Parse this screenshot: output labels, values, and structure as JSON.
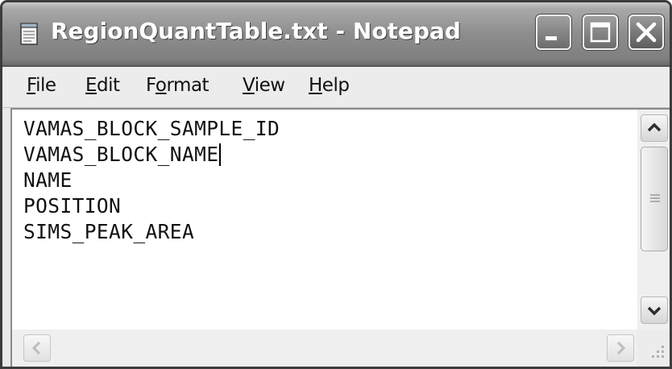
{
  "window": {
    "title": "RegionQuantTable.txt - Notepad",
    "icons": {
      "app": "notepad-icon",
      "minimize": "minimize-icon",
      "maximize": "maximize-icon",
      "close": "close-icon"
    }
  },
  "menu": [
    {
      "mnemonic": "F",
      "rest": "ile"
    },
    {
      "mnemonic": "E",
      "rest": "dit"
    },
    {
      "pre": "F",
      "mnemonic": "o",
      "rest": "rmat"
    },
    {
      "mnemonic": "V",
      "rest": "iew"
    },
    {
      "mnemonic": "H",
      "rest": "elp"
    }
  ],
  "editor": {
    "lines": [
      "VAMAS_BLOCK_SAMPLE_ID",
      "VAMAS_BLOCK_NAME",
      "NAME",
      "POSITION",
      "SIMS_PEAK_AREA"
    ]
  },
  "scrollbars": {
    "vertical": {
      "up": "arrow-up-icon",
      "down": "arrow-down-icon",
      "thumb_grip": "grip-lines-icon"
    },
    "horizontal": {
      "left": "arrow-left-icon",
      "right": "arrow-right-icon"
    },
    "size_grip": "resize-grip-icon"
  }
}
